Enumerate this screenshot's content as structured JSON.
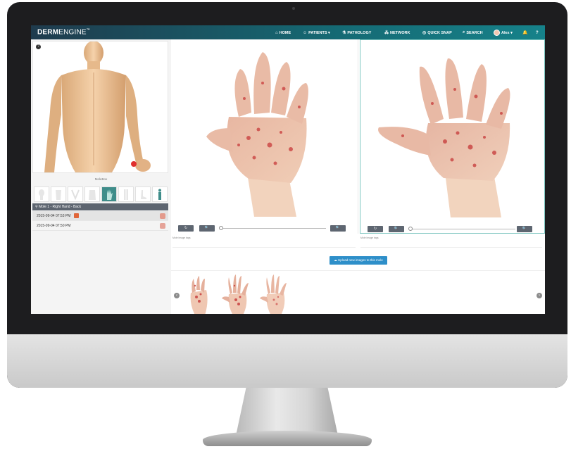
{
  "app": {
    "logo_bold": "DERM",
    "logo_light": "ENGINE",
    "logo_tm": "™"
  },
  "nav": {
    "items": [
      {
        "label": "HOME",
        "icon": "home-icon"
      },
      {
        "label": "PATIENTS ▾",
        "icon": "patients-icon"
      },
      {
        "label": "PATHOLOGY",
        "icon": "microscope-icon"
      },
      {
        "label": "NETWORK",
        "icon": "network-icon"
      },
      {
        "label": "QUICK SNAP",
        "icon": "camera-icon"
      },
      {
        "label": "SEARCH",
        "icon": "search-icon"
      }
    ],
    "user": "Alex ▾",
    "bell_glyph": "🔔",
    "help_glyph": "?"
  },
  "left_panel": {
    "help_glyph": "?",
    "moleblox_label": "MoleBox",
    "mole_header": "Mole 1 - Right Hand - Back",
    "rows": [
      {
        "date": "2015-09-04 07:53 PM"
      },
      {
        "date": "2015-09-04 07:50 PM"
      }
    ]
  },
  "viewer": {
    "rotate_glyph": "↻",
    "zoom_glyph": "🔍",
    "tags_label": "Mole image tags"
  },
  "upload_label": "Upload new images to this mole",
  "gallery": {
    "prev_glyph": "‹",
    "next_glyph": "›"
  },
  "colors": {
    "nav_start": "#1f3b4d",
    "nav_end": "#16828a",
    "accent": "#3f8d8a",
    "button": "#2e8fc9",
    "badge": "#e0663a"
  }
}
